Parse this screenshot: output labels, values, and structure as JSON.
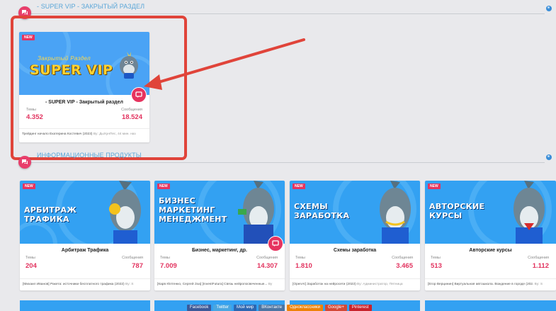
{
  "sections": [
    {
      "title": "- SUPER VIP - ЗАКРЫТЫЙ РАЗДЕЛ"
    },
    {
      "title": "ИНФОРМАЦИОННЫЕ ПРОДУКТЫ"
    }
  ],
  "vip_card": {
    "badge": "NEW",
    "banner_top": "Закрытый Раздел",
    "banner_main": "SUPER VIP",
    "name": "- SUPER VIP - Закрытый раздел",
    "topics_label": "Темы",
    "topics": "4.352",
    "posts_label": "Сообщения",
    "posts": "18.524",
    "last_post": "Трейдинг начало Екатерина Костевич (2023)",
    "last_by": "By: ДыХунПес, 44 мин. наз"
  },
  "cards": [
    {
      "badge": "NEW",
      "banner": "АРБИТРАЖ\nТРАФИКА",
      "name": "Арбитраж Трафика",
      "topics_label": "Темы",
      "topics": "204",
      "posts_label": "Сообщения",
      "posts": "787",
      "last_post": "[Михаил Иванов] Ракета: источники бесплатного трафика (2022)",
      "last_by": "By: S"
    },
    {
      "badge": "NEW",
      "banner": "БИЗНЕС\nМАРКЕТИНГ\nМЕНЕДЖМЕНТ",
      "name": "Бизнес, маркетинг, др.",
      "topics_label": "Темы",
      "topics": "7.009",
      "posts_label": "Сообщения",
      "posts": "14.307",
      "last_post": "[Карв Юлтенко, Сергей Зэа] [InvestFutura] Связь нейропосвеченные...",
      "last_by": "By"
    },
    {
      "badge": "NEW",
      "banner": "СХЕМЫ\nЗАРАБОТКА",
      "name": "Схемы заработка",
      "topics_label": "Темы",
      "topics": "1.810",
      "posts_label": "Сообщения",
      "posts": "3.465",
      "last_post": "[OpenAI] Заработок на нейросети (2023)",
      "last_by": "By: Администратор, Пятница"
    },
    {
      "badge": "NEW",
      "banner": "АВТОРСКИЕ\nКУРСЫ",
      "name": "Авторские курсы",
      "topics_label": "Темы",
      "topics": "513",
      "posts_label": "Сообщения",
      "posts": "1.112",
      "last_post": "[Егор Верцинин] Виртуальная автошкола. Вождение в городе (202.",
      "last_by": "By: S"
    }
  ],
  "share_bar": [
    "Facebook",
    "Twitter",
    "Мой мир",
    "ВКонтакте",
    "Одноклассники",
    "Google+",
    "Pinterest"
  ],
  "colors": {
    "accent": "#e6345f",
    "banner": "#33a1f2",
    "highlight": "#e0443a",
    "section_title": "#5aa6d8"
  },
  "icons": [
    "chat-icon",
    "collapse-icon",
    "shark-mascot-icon",
    "comment-icon",
    "red-arrow"
  ]
}
